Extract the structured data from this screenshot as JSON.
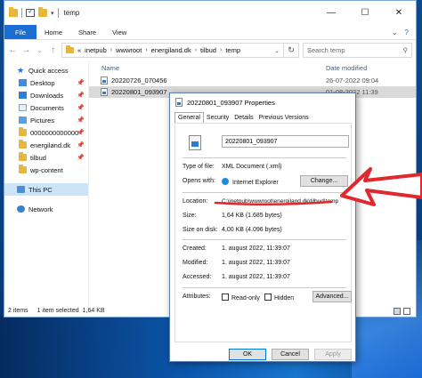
{
  "explorer": {
    "title": "temp",
    "window_controls": [
      "—",
      "☐",
      "✕"
    ],
    "ribbon_tabs": [
      "File",
      "Home",
      "Share",
      "View"
    ],
    "address": [
      "«",
      "inetpub",
      "wwwroot",
      "energiland.dk",
      "tilbud",
      "temp"
    ],
    "search_placeholder": "Search temp",
    "nav_pane": {
      "quick_access": "Quick access",
      "items": [
        "Desktop",
        "Downloads",
        "Documents",
        "Pictures",
        "0000000000000",
        "energiland.dk",
        "tilbud",
        "wp-content"
      ],
      "this_pc": "This PC",
      "network": "Network"
    },
    "columns": {
      "name": "Name",
      "date": "Date modified"
    },
    "files": [
      {
        "name": "20220726_070456",
        "date": "26-07-2022 09:04"
      },
      {
        "name": "20220801_093907",
        "date": "01-08-2022 11:39"
      }
    ],
    "status": {
      "count": "2 items",
      "selected": "1 item selected",
      "size": "1,64 KB"
    }
  },
  "dialog": {
    "title": "20220801_093907 Properties",
    "tabs": [
      "General",
      "Security",
      "Details",
      "Previous Versions"
    ],
    "filename": "20220801_093907",
    "type_label": "Type of file:",
    "type_value": "XML Document (.xml)",
    "opens_label": "Opens with:",
    "opens_value": "Internet Explorer",
    "change_button": "Change...",
    "location_label": "Location:",
    "location_value": "C:\\inetpub\\wwwroot\\energiland.dk\\tilbud\\temp",
    "size_label": "Size:",
    "size_value": "1,64 KB (1.685 bytes)",
    "disk_label": "Size on disk:",
    "disk_value": "4,00 KB (4.096 bytes)",
    "created_label": "Created:",
    "created_value": "1. august 2022, 11:39:07",
    "modified_label": "Modified:",
    "modified_value": "1. august 2022, 11:39:07",
    "accessed_label": "Accessed:",
    "accessed_value": "1. august 2022, 11:39:07",
    "attributes_label": "Attributes:",
    "readonly_label": "Read-only",
    "hidden_label": "Hidden",
    "advanced_button": "Advanced...",
    "ok_button": "OK",
    "cancel_button": "Cancel",
    "apply_button": "Apply"
  },
  "colors": {
    "accent": "#1a6dd2",
    "annotation": "#e0282e"
  }
}
